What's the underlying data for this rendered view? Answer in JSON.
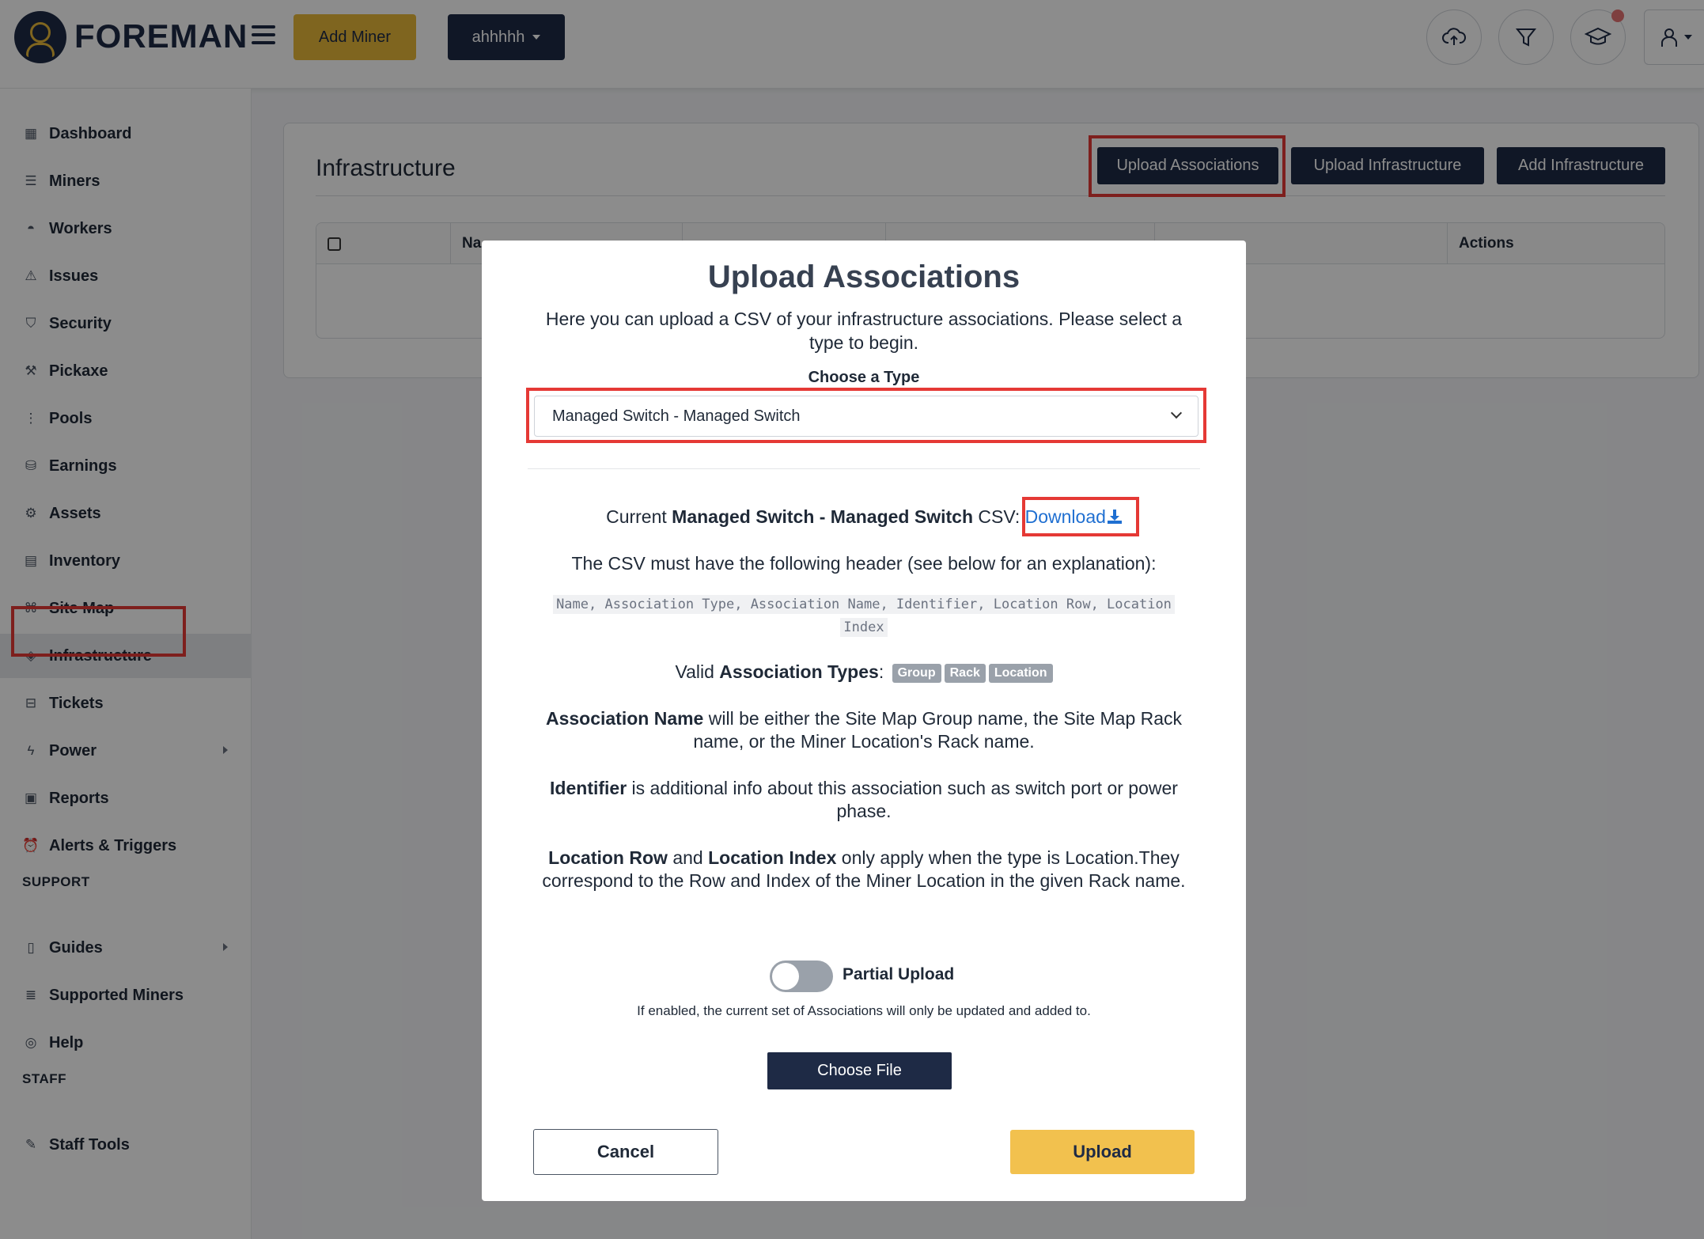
{
  "header": {
    "brand": "FOREMAN",
    "add_miner_label": "Add Miner",
    "org_label": "ahhhhh",
    "icons": [
      "cloud-upload-icon",
      "filter-icon",
      "graduation-cap-icon",
      "user-icon"
    ]
  },
  "sidebar": {
    "items": [
      {
        "label": "Dashboard",
        "icon": "dashboard-icon"
      },
      {
        "label": "Miners",
        "icon": "server-icon"
      },
      {
        "label": "Workers",
        "icon": "hardhat-icon"
      },
      {
        "label": "Issues",
        "icon": "warning-icon"
      },
      {
        "label": "Security",
        "icon": "shield-icon"
      },
      {
        "label": "Pickaxe",
        "icon": "pickaxe-icon"
      },
      {
        "label": "Pools",
        "icon": "pools-icon"
      },
      {
        "label": "Earnings",
        "icon": "earnings-icon"
      },
      {
        "label": "Assets",
        "icon": "gear-icon"
      },
      {
        "label": "Inventory",
        "icon": "inventory-icon"
      },
      {
        "label": "Site Map",
        "icon": "sitemap-icon"
      },
      {
        "label": "Infrastructure",
        "icon": "layers-icon"
      },
      {
        "label": "Tickets",
        "icon": "ticket-icon"
      },
      {
        "label": "Power",
        "icon": "bolt-icon"
      },
      {
        "label": "Reports",
        "icon": "report-icon"
      },
      {
        "label": "Alerts & Triggers",
        "icon": "alarm-icon"
      }
    ],
    "support_heading": "SUPPORT",
    "support_items": [
      {
        "label": "Guides",
        "icon": "book-icon"
      },
      {
        "label": "Supported Miners",
        "icon": "list-icon"
      },
      {
        "label": "Help",
        "icon": "lifebuoy-icon"
      }
    ],
    "staff_heading": "STAFF",
    "staff_items": [
      {
        "label": "Staff Tools",
        "icon": "tools-icon"
      }
    ],
    "active": "Infrastructure"
  },
  "main": {
    "title": "Infrastructure",
    "buttons": {
      "upload_associations": "Upload Associations",
      "upload_infrastructure": "Upload Infrastructure",
      "add_infrastructure": "Add Infrastructure"
    },
    "table": {
      "col_name_partial": "Na",
      "col_actions": "Actions"
    }
  },
  "modal": {
    "title": "Upload Associations",
    "intro": "Here you can upload a CSV of your infrastructure associations. Please select a type to begin.",
    "choose_label": "Choose a Type",
    "selected_type": "Managed Switch - Managed Switch",
    "current_prefix": "Current ",
    "current_type": "Managed Switch - Managed Switch",
    "current_suffix": " CSV: ",
    "download_label": "Download",
    "header_note": "The CSV must have the following header (see below for an explanation):",
    "csv_header_line1": "Name, Association Type, Association Name, Identifier, Location Row, Location",
    "csv_header_line2": "Index",
    "valid_prefix": "Valid ",
    "valid_bold": "Association Types",
    "valid_colon": ":",
    "types": [
      "Group",
      "Rack",
      "Location"
    ],
    "assoc_name_bold": "Association Name",
    "assoc_name_text": " will be either the Site Map Group name, the Site Map Rack name, or the Miner Location's Rack name.",
    "identifier_bold": "Identifier",
    "identifier_text": " is additional info about this association such as switch port or power phase.",
    "loc_row_bold": "Location Row",
    "loc_and": " and ",
    "loc_index_bold": "Location Index",
    "loc_text": " only apply when the type is Location.They correspond to the Row and Index of the Miner Location in the given Rack name.",
    "partial_label": "Partial Upload",
    "partial_enabled": false,
    "partial_hint": "If enabled, the current set of Associations will only be updated and added to.",
    "choose_file_label": "Choose File",
    "cancel_label": "Cancel",
    "upload_label": "Upload"
  },
  "colors": {
    "navy": "#1e2a45",
    "gold": "#e8b83a",
    "upload_gold": "#f2c14e",
    "link": "#1f6fd1",
    "highlight": "#e53935"
  }
}
